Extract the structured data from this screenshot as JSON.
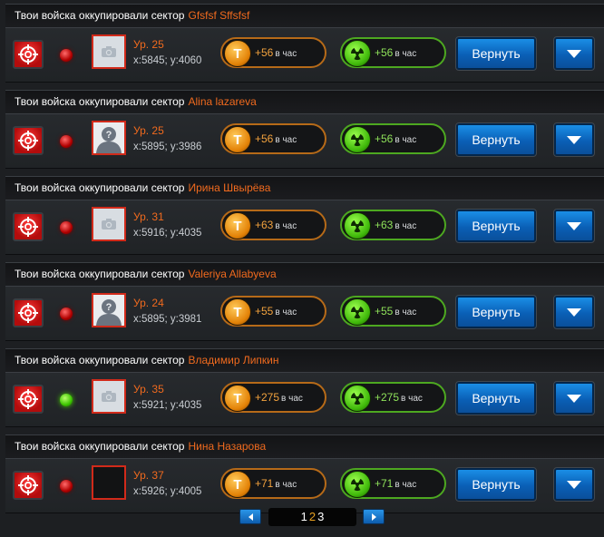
{
  "header_prefix": "Твои войска оккупировали сектор",
  "return_label": "Вернуть",
  "unit_label": "в час",
  "icons": {
    "target": "target-icon",
    "tech_resource": "t-coin-icon",
    "radiation_resource": "radiation-icon",
    "dropdown": "chevron-down-icon",
    "avatar_placeholder": "camera-icon",
    "avatar_silhouette": "unknown-person-icon"
  },
  "colors": {
    "accent_orange": "#f06a1e",
    "button_blue": "#0a6fcf",
    "status_red": "#d10000",
    "status_green": "#3bc400"
  },
  "sectors": [
    {
      "name": "Gfsfsf Sffsfsf",
      "status": "red",
      "avatar": "camera",
      "level": "Ур. 25",
      "coords": "x:5845; y:4060",
      "tech": "+56",
      "radiation": "+56"
    },
    {
      "name": "Alina lazareva",
      "status": "red",
      "avatar": "person",
      "level": "Ур. 25",
      "coords": "x:5895; y:3986",
      "tech": "+56",
      "radiation": "+56"
    },
    {
      "name": "Ирина Швырёва",
      "status": "red",
      "avatar": "camera",
      "level": "Ур. 31",
      "coords": "x:5916; y:4035",
      "tech": "+63",
      "radiation": "+63"
    },
    {
      "name": "Valeriya Allabyeva",
      "status": "red",
      "avatar": "person",
      "level": "Ур. 24",
      "coords": "x:5895; y:3981",
      "tech": "+55",
      "radiation": "+55"
    },
    {
      "name": "Владимир Липкин",
      "status": "green",
      "avatar": "camera",
      "level": "Ур. 35",
      "coords": "x:5921; y:4035",
      "tech": "+275",
      "radiation": "+275"
    },
    {
      "name": "Нина Назарова",
      "status": "red",
      "avatar": "empty",
      "level": "Ур. 37",
      "coords": "x:5926; y:4005",
      "tech": "+71",
      "radiation": "+71"
    }
  ],
  "pagination": {
    "pages": [
      "1",
      "2",
      "3"
    ],
    "current": "2"
  }
}
